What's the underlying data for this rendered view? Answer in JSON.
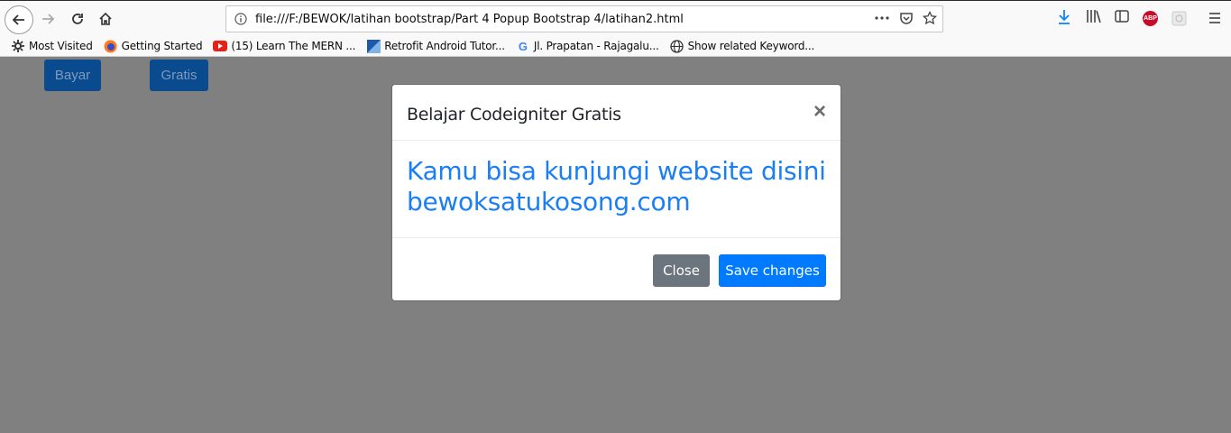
{
  "browser": {
    "url": "file:///F:/BEWOK/latihan bootstrap/Part 4 Popup Bootstrap 4/latihan2.html",
    "bookmarks": [
      {
        "label": "Most Visited",
        "icon": "gear-icon"
      },
      {
        "label": "Getting Started",
        "icon": "firefox-icon"
      },
      {
        "label": "(15) Learn The MERN ...",
        "icon": "youtube-icon"
      },
      {
        "label": "Retrofit Android Tutor...",
        "icon": "retrofit-icon"
      },
      {
        "label": "Jl. Prapatan - Rajagalu...",
        "icon": "google-icon"
      },
      {
        "label": "Show related Keyword...",
        "icon": "globe-icon"
      }
    ],
    "adblock_label": "ABP"
  },
  "page": {
    "btn_bayar": "Bayar",
    "btn_gratis": "Gratis"
  },
  "modal": {
    "title": "Belajar Codeigniter Gratis",
    "close_symbol": "×",
    "body_line1": "Kamu bisa kunjungi website disini",
    "body_line2": "bewoksatukosong.com",
    "btn_close": "Close",
    "btn_save": "Save changes"
  },
  "colors": {
    "overlay": "#808080",
    "primary": "#007bff",
    "secondary": "#6c757d",
    "link": "#1a7ef5"
  }
}
